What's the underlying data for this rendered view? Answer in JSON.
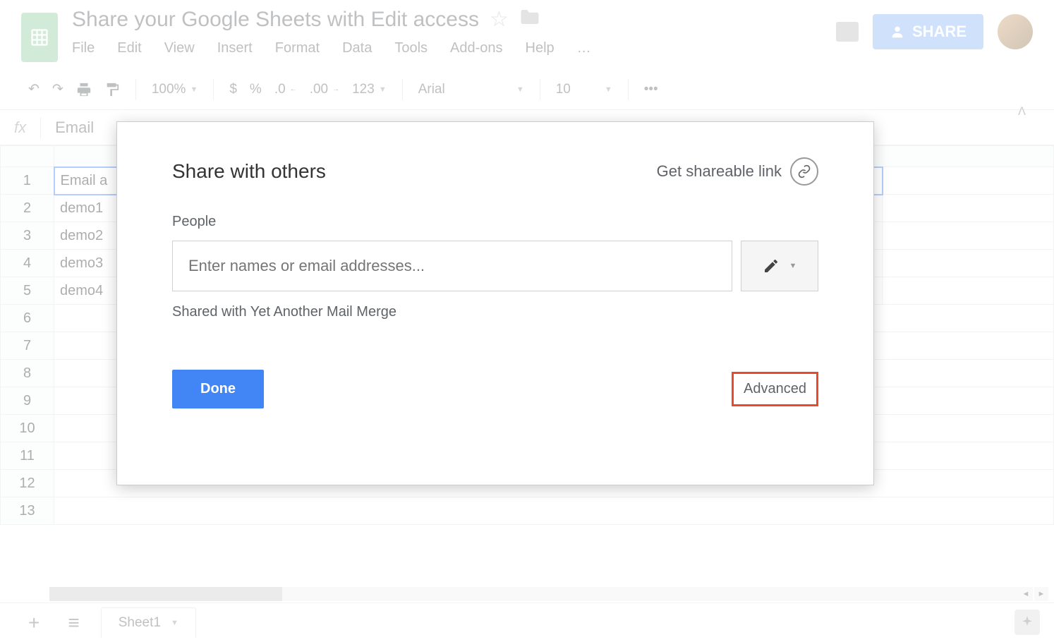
{
  "doc": {
    "title": "Share your Google Sheets with Edit access"
  },
  "menu": {
    "file": "File",
    "edit": "Edit",
    "view": "View",
    "insert": "Insert",
    "format": "Format",
    "data": "Data",
    "tools": "Tools",
    "addons": "Add-ons",
    "help": "Help",
    "more": "…"
  },
  "share_button": "SHARE",
  "toolbar": {
    "zoom": "100%",
    "currency": "$",
    "percent": "%",
    "dec_less": ".0",
    "dec_more": ".00",
    "num_format": "123",
    "font": "Arial",
    "font_size": "10",
    "more": "•••"
  },
  "formula_bar": {
    "fx": "fx",
    "value": "Email"
  },
  "grid": {
    "rows": [
      "1",
      "2",
      "3",
      "4",
      "5",
      "6",
      "7",
      "8",
      "9",
      "10",
      "11",
      "12",
      "13"
    ],
    "colA": [
      "Email a",
      "demo1",
      "demo2",
      "demo3",
      "demo4"
    ]
  },
  "dialog": {
    "title": "Share with others",
    "get_link": "Get shareable link",
    "people_label": "People",
    "input_placeholder": "Enter names or email addresses...",
    "shared_with": "Shared with Yet Another Mail Merge",
    "done": "Done",
    "advanced": "Advanced"
  },
  "bottom": {
    "sheet1": "Sheet1"
  }
}
